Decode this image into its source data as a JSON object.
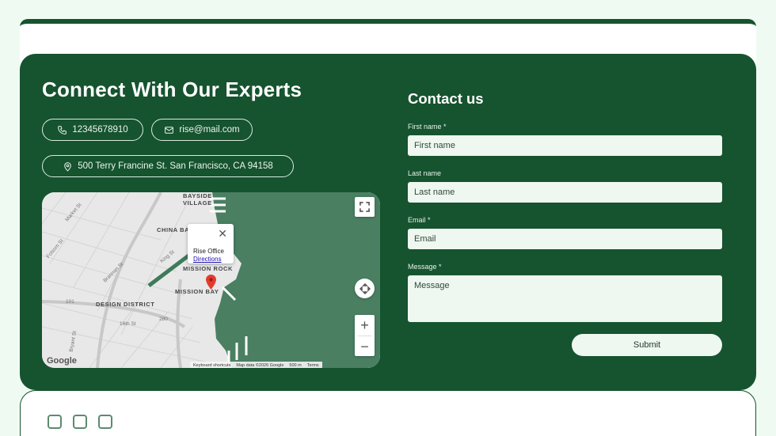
{
  "expert": {
    "heading": "Connect With Our Experts",
    "phone": "12345678910",
    "email": "rise@mail.com",
    "address": "500 Terry Francine St. San Francisco, CA 94158"
  },
  "map": {
    "popup_title": "Rise Office",
    "popup_link": "Directions",
    "labels": {
      "bayside": "BAYSIDE",
      "village": "VILLAGE",
      "china_basin": "CHINA BASIN",
      "mission_rock": "MISSION ROCK",
      "mission_bay": "MISSION BAY",
      "design_district": "DESIGN DISTRICT",
      "market_st": "Market St",
      "folsom_st": "Folsom St",
      "king_st": "King St",
      "brannan_st": "Brannan St",
      "sixteenth_st": "16th St",
      "route_101": "101",
      "route_280": "280",
      "bryant_st": "Bryant St"
    },
    "google": "Google",
    "footer": {
      "shortcuts": "Keyboard shortcuts",
      "map_data": "Map data ©2026 Google",
      "scale": "500 m",
      "terms": "Terms"
    },
    "water_color": "#4a7f62"
  },
  "form": {
    "title": "Contact us",
    "first_name_label": "First name *",
    "first_name_placeholder": "First name",
    "last_name_label": "Last name",
    "last_name_placeholder": "Last name",
    "email_label": "Email *",
    "email_placeholder": "Email",
    "message_label": "Message *",
    "message_placeholder": "Message",
    "submit": "Submit"
  },
  "colors": {
    "brand_green": "#16532f",
    "page_bg": "#effbf2",
    "field_bg": "#eef7f0"
  }
}
